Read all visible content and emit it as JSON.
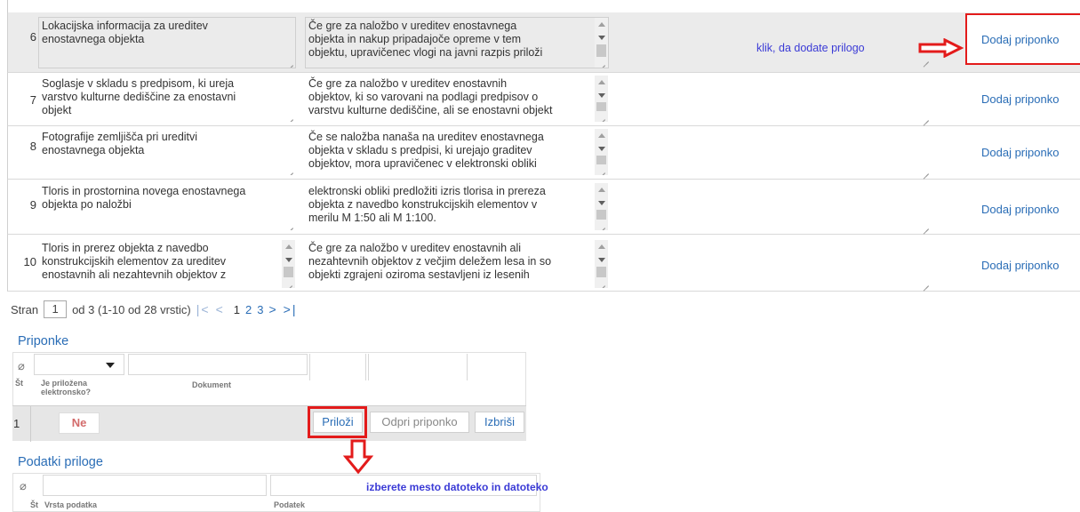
{
  "rows": [
    {
      "num": "6",
      "name": "Lokacijska informacija za ureditev\nenostavnega objekta",
      "desc": "Če gre za naložbo v ureditev enostavnega\nobjekta in nakup pripadajoče opreme v tem\nobjektu, upravičenec vlogi na javni razpis priloži",
      "action": "Dodaj priponko"
    },
    {
      "num": "7",
      "name": "Soglasje v skladu s predpisom, ki ureja\nvarstvo kulturne dediščine za enostavni\nobjekt",
      "desc": "Če gre za naložbo v ureditev enostavnih\nobjektov, ki so varovani na podlagi predpisov o\nvarstvu kulturne dediščine, ali se enostavni objekt",
      "action": "Dodaj priponko"
    },
    {
      "num": "8",
      "name": "Fotografije zemljišča pri ureditvi\nenostavnega objekta",
      "desc": "Če se naložba nanaša na ureditev enostavnega\nobjekta v skladu s predpisi, ki urejajo graditev\nobjektov, mora upravičenec v elektronski obliki",
      "action": "Dodaj priponko"
    },
    {
      "num": "9",
      "name": "Tloris in prostornina novega enostavnega\nobjekta po naložbi",
      "desc": "elektronski obliki predložiti izris tlorisa in prereza\nobjekta z navedbo konstrukcijskih elementov v\nmerilu M 1:50 ali M 1:100.",
      "action": "Dodaj priponko"
    },
    {
      "num": "10",
      "name": "Tloris in prerez objekta z navedbo\nkonstrukcijskih elementov za ureditev\nenostavnih ali nezahtevnih objektov z",
      "desc": "Če gre za naložbo v ureditev enostavnih ali\nnezahtevnih objektov z večjim deležem lesa in so\nobjekti zgrajeni oziroma sestavljeni iz lesenih",
      "action": "Dodaj priponko"
    }
  ],
  "annotation_top": "klik, da dodate prilogo",
  "pager": {
    "prefix": "Stran",
    "page": "1",
    "suffix": "od 3 (1-10 od 28 vrstic)",
    "nav_first": "|<",
    "nav_prev": "<",
    "pages": [
      "1",
      "2",
      "3"
    ],
    "nav_next": ">",
    "nav_last": ">|"
  },
  "priponke": {
    "title": "Priponke",
    "col_st": "Št",
    "col_elec": "Je priložena\nelektronsko?",
    "col_doc": "Dokument",
    "row_num": "1",
    "row_value": "Ne",
    "btn_attach": "Priloži",
    "btn_open": "Odpri priponko",
    "btn_delete": "Izbriši"
  },
  "podatki": {
    "title": "Podatki priloge",
    "col_st": "Št",
    "col_type": "Vrsta podatka",
    "col_data": "Podatek",
    "annotation": "izberete mesto datoteko in datoteko"
  },
  "colors": {
    "accent": "#2a6db6",
    "highlight": "#e31b1b",
    "annotation": "#3b3bd6"
  }
}
